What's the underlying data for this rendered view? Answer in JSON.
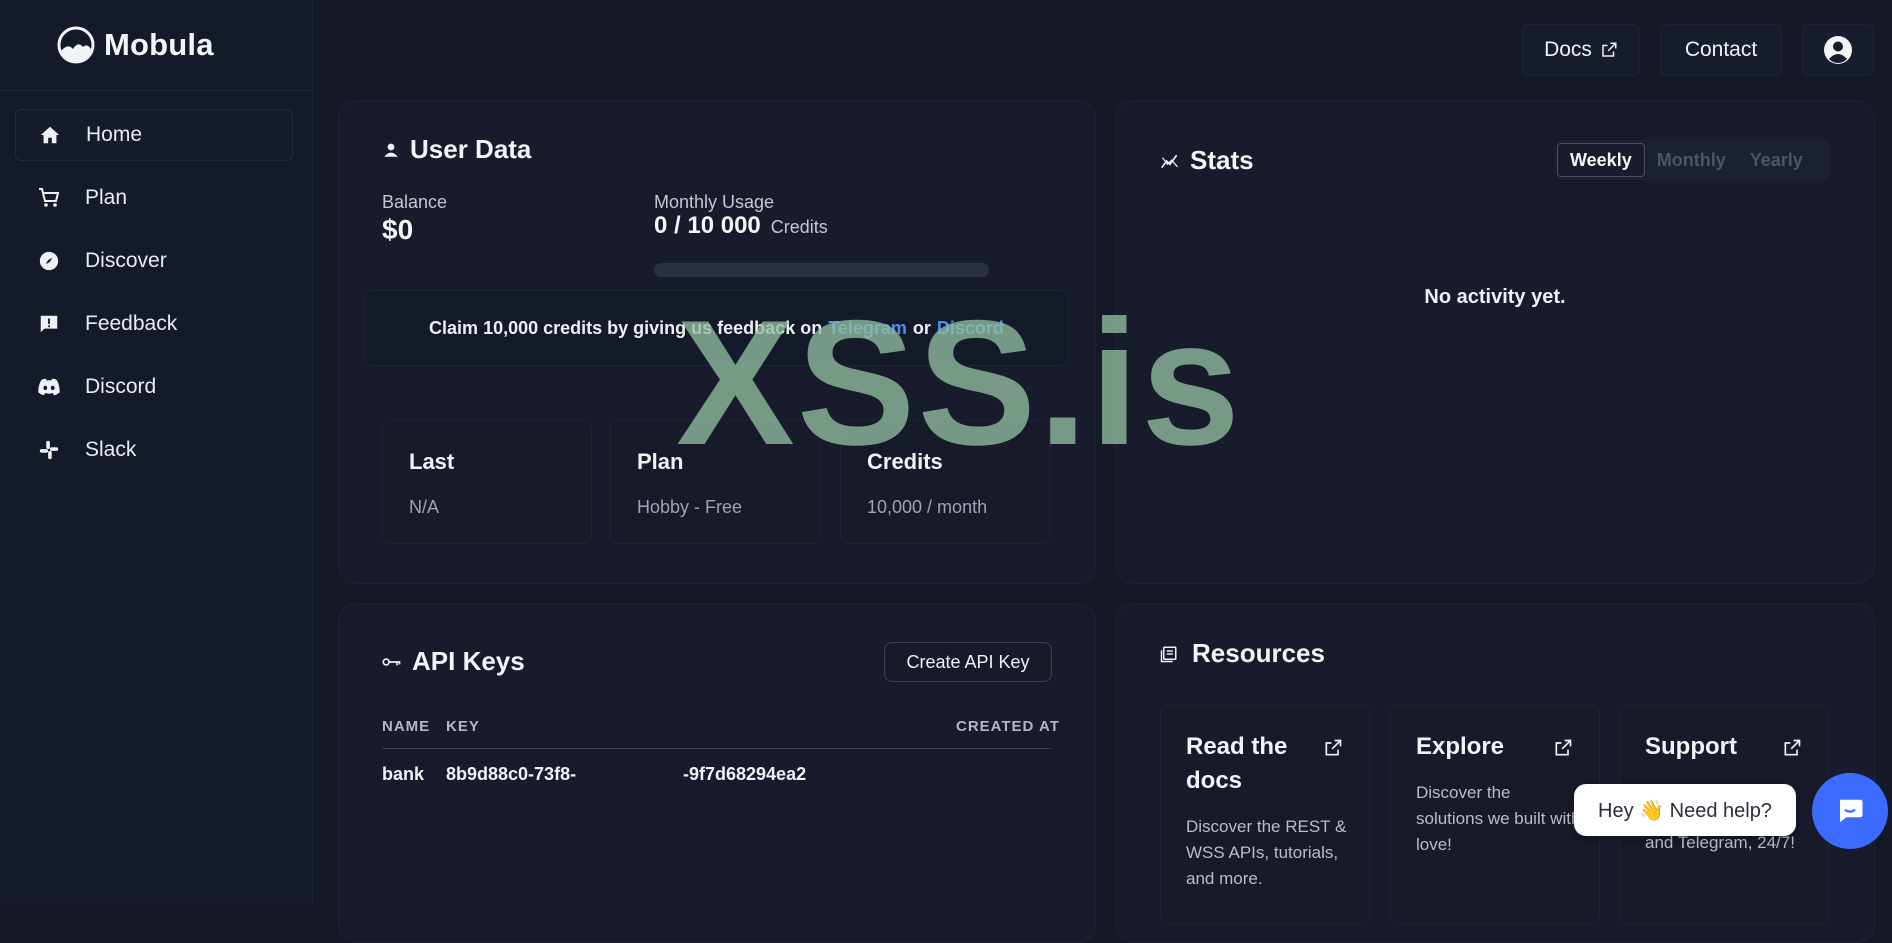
{
  "brand": {
    "name": "Mobula"
  },
  "nav": [
    {
      "label": "Home",
      "icon": "home-icon"
    },
    {
      "label": "Plan",
      "icon": "cart-icon"
    },
    {
      "label": "Discover",
      "icon": "compass-icon"
    },
    {
      "label": "Feedback",
      "icon": "feedback-icon"
    },
    {
      "label": "Discord",
      "icon": "discord-icon"
    },
    {
      "label": "Slack",
      "icon": "slack-icon"
    }
  ],
  "topbar": {
    "docs_label": "Docs",
    "contact_label": "Contact"
  },
  "user_data": {
    "title": "User Data",
    "balance_label": "Balance",
    "balance_value": "$0",
    "usage_label": "Monthly Usage",
    "usage_value": "0 / 10 000",
    "usage_unit": "Credits",
    "usage_fraction": 0,
    "claim_prefix": "Claim 10,000 credits by giving us feedback on",
    "claim_link1": "Telegram",
    "claim_or": "or",
    "claim_link2": "Discord",
    "boxes": [
      {
        "title": "Last",
        "value": "N/A"
      },
      {
        "title": "Plan",
        "value": "Hobby - Free"
      },
      {
        "title": "Credits",
        "value": "10,000 / month"
      }
    ]
  },
  "stats": {
    "title": "Stats",
    "tabs": [
      "Weekly",
      "Monthly",
      "Yearly"
    ],
    "active_tab": "Weekly",
    "empty": "No activity yet."
  },
  "api_keys": {
    "title": "API Keys",
    "create_label": "Create API Key",
    "columns": [
      "NAME",
      "KEY",
      "CREATED AT"
    ],
    "rows": [
      {
        "name": "bank",
        "key_start": "8b9d88c0-73f8-",
        "key_end": "-9f7d68294ea2"
      }
    ]
  },
  "resources": {
    "title": "Resources",
    "items": [
      {
        "title": "Read the docs",
        "desc": "Discover the REST & WSS APIs, tutorials, and more."
      },
      {
        "title": "Explore",
        "desc": "Discover the solutions we built with love!"
      },
      {
        "title": "Support",
        "desc": "and Telegram, 24/7!"
      }
    ]
  },
  "chat": {
    "bubble": "Hey 👋 Need help?"
  },
  "watermark": "XSS.is",
  "colors": {
    "accent": "#3b6cff",
    "link": "#4b8ff6",
    "background": "#141827"
  }
}
